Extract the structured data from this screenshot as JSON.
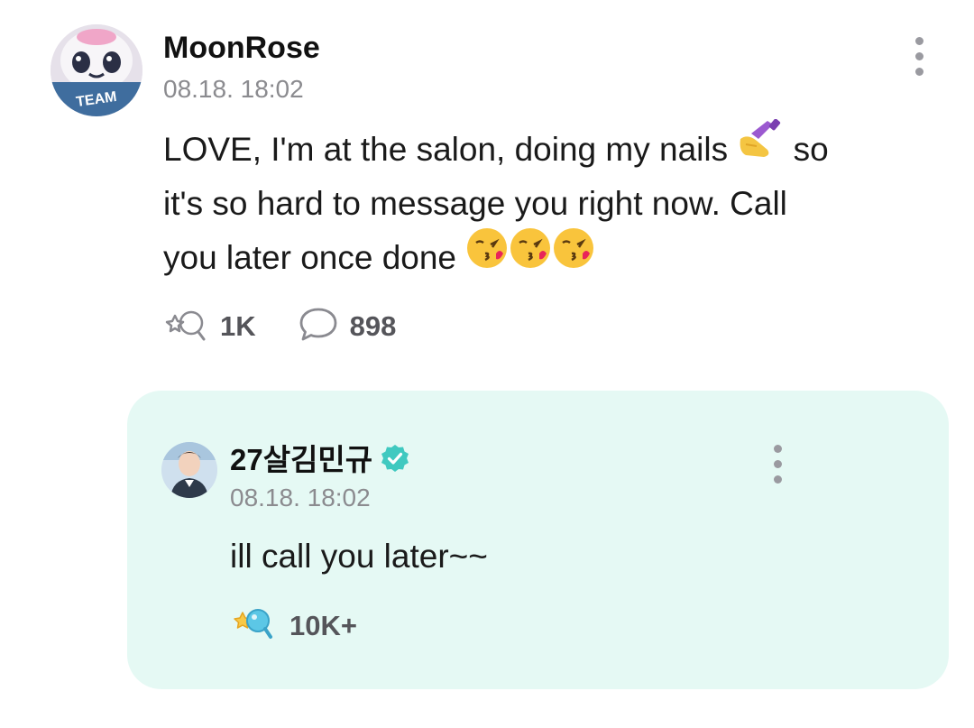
{
  "post": {
    "author": "MoonRose",
    "time": "08.18. 18:02",
    "body": {
      "line1_a": "LOVE, I'm at the salon, doing my nails ",
      "line1_b": " so",
      "line2": "it's so hard to message you right now. Call",
      "line3": "you later once done "
    },
    "reactions_count": "1K",
    "comments_count": "898",
    "avatar_badge_text": "TEAM"
  },
  "reply": {
    "author": "27살김민규",
    "time": "08.18. 18:02",
    "text": "ill call you later~~",
    "reactions_count": "10K+"
  },
  "icons": {
    "post_more": "more-vertical-icon",
    "reaction": "reaction-outline-icon",
    "comment": "comment-bubble-icon",
    "verified": "verified-badge-icon",
    "reply_reaction": "reaction-filled-icon",
    "nail_emoji": "nail-polish-emoji",
    "kiss_emoji": "kissing-face-emoji"
  },
  "colors": {
    "reply_background": "#e5f9f4",
    "verified": "#40c9c0",
    "secondary_text": "#8b8b8f"
  }
}
